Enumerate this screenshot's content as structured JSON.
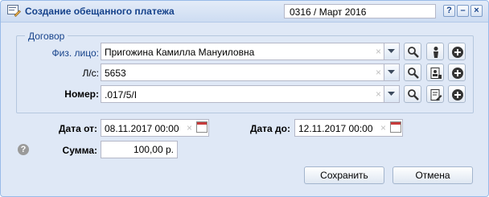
{
  "window": {
    "title": "Создание обещанного платежа",
    "period": "0316 / Март 2016",
    "tools": {
      "help": "?",
      "minimize": "–",
      "close": "×"
    }
  },
  "contract": {
    "legend": "Договор",
    "person": {
      "label": "Физ. лицо:",
      "value": "Пригожина Камилла Мануиловна"
    },
    "account": {
      "label": "Л/с:",
      "value": "5653"
    },
    "number": {
      "label": "Номер:",
      "value": ".017/5/I"
    },
    "clear_glyph": "×"
  },
  "dates": {
    "from": {
      "label": "Дата от:",
      "value": "08.11.2017 00:00"
    },
    "to": {
      "label": "Дата до:",
      "value": "12.11.2017 00:00"
    }
  },
  "amount": {
    "label": "Сумма:",
    "value": "100,00 р."
  },
  "help_glyph": "?",
  "actions": {
    "save": "Сохранить",
    "cancel": "Отмена"
  },
  "icons": {
    "app": "form-edit-icon",
    "search": "magnifier-icon",
    "person": "person-card-icon",
    "account": "account-card-icon",
    "document": "document-edit-icon",
    "add": "plus-circle-icon",
    "calendar": "calendar-icon"
  }
}
